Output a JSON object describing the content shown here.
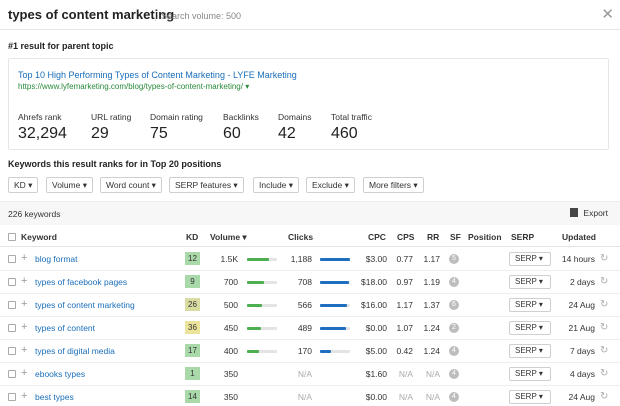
{
  "header": {
    "title": "types of content marketing",
    "search_volume": "Search volume: 500",
    "close_icon": "close-icon"
  },
  "parent": {
    "heading": "#1 result for parent topic",
    "link": "Top 10 High Performing Types of Content Marketing - LYFE Marketing",
    "url": "https://www.lyfemarketing.com/blog/types-of-content-marketing/ ▾",
    "metrics": [
      {
        "label": "Ahrefs rank",
        "value": "32,294"
      },
      {
        "label": "URL rating",
        "value": "29"
      },
      {
        "label": "Domain rating",
        "value": "75"
      },
      {
        "label": "Backlinks",
        "value": "60"
      },
      {
        "label": "Domains",
        "value": "42"
      },
      {
        "label": "Total traffic",
        "value": "460"
      }
    ]
  },
  "keywords_heading": "Keywords this result ranks for in Top 20 positions",
  "filters": [
    "KD ▾",
    "Volume ▾",
    "Word count ▾",
    "SERP features ▾",
    "Include ▾",
    "Exclude ▾",
    "More filters ▾"
  ],
  "summary": {
    "count": "226 keywords",
    "export": "Export"
  },
  "table": {
    "columns": {
      "keyword": "Keyword",
      "kd": "KD",
      "volume": "Volume ▾",
      "clicks": "Clicks",
      "cpc": "CPC",
      "cps": "CPS",
      "rr": "RR",
      "sf": "SF",
      "position": "Position",
      "serp": "SERP",
      "updated": "Updated"
    },
    "rows": [
      {
        "keyword": "blog format",
        "kd": "12",
        "kd_color": "#a9d8a9",
        "volume": "1.5K",
        "volume_frac": 0.72,
        "clicks": "1,188",
        "clicks_frac": 1.0,
        "cpc": "$3.00",
        "cps": "0.77",
        "rr": "1.17",
        "sf": "5",
        "serp": "SERP ▾",
        "updated": "14 hours"
      },
      {
        "keyword": "types of facebook pages",
        "kd": "9",
        "kd_color": "#a9d8a9",
        "volume": "700",
        "volume_frac": 0.55,
        "clicks": "708",
        "clicks_frac": 0.95,
        "cpc": "$18.00",
        "cps": "0.97",
        "rr": "1.19",
        "sf": "4",
        "serp": "SERP ▾",
        "updated": "2 days"
      },
      {
        "keyword": "types of content marketing",
        "kd": "26",
        "kd_color": "#d9dca0",
        "volume": "500",
        "volume_frac": 0.5,
        "clicks": "566",
        "clicks_frac": 0.9,
        "cpc": "$16.00",
        "cps": "1.17",
        "rr": "1.37",
        "sf": "6",
        "serp": "SERP ▾",
        "updated": "24 Aug"
      },
      {
        "keyword": "types of content",
        "kd": "36",
        "kd_color": "#ece49a",
        "volume": "450",
        "volume_frac": 0.48,
        "clicks": "489",
        "clicks_frac": 0.88,
        "cpc": "$0.00",
        "cps": "1.07",
        "rr": "1.24",
        "sf": "2",
        "serp": "SERP ▾",
        "updated": "21 Aug"
      },
      {
        "keyword": "types of digital media",
        "kd": "17",
        "kd_color": "#a9d8a9",
        "volume": "400",
        "volume_frac": 0.4,
        "clicks": "170",
        "clicks_frac": 0.35,
        "cpc": "$5.00",
        "cps": "0.42",
        "rr": "1.24",
        "sf": "4",
        "serp": "SERP ▾",
        "updated": "7 days"
      },
      {
        "keyword": "ebooks types",
        "kd": "1",
        "kd_color": "#a9d8a9",
        "volume": "350",
        "volume_frac": 0,
        "clicks": "N/A",
        "clicks_frac": 0,
        "cpc": "$1.60",
        "cps": "N/A",
        "rr": "N/A",
        "sf": "4",
        "serp": "SERP ▾",
        "updated": "4 days"
      },
      {
        "keyword": "best types",
        "kd": "14",
        "kd_color": "#a9d8a9",
        "volume": "350",
        "volume_frac": 0,
        "clicks": "N/A",
        "clicks_frac": 0,
        "cpc": "$0.00",
        "cps": "N/A",
        "rr": "N/A",
        "sf": "4",
        "serp": "SERP ▾",
        "updated": "24 Aug"
      }
    ]
  },
  "colors": {
    "link": "#1a6eb9",
    "volume_bar": "#4caf50",
    "clicks_bar": "#1e6fc0"
  }
}
